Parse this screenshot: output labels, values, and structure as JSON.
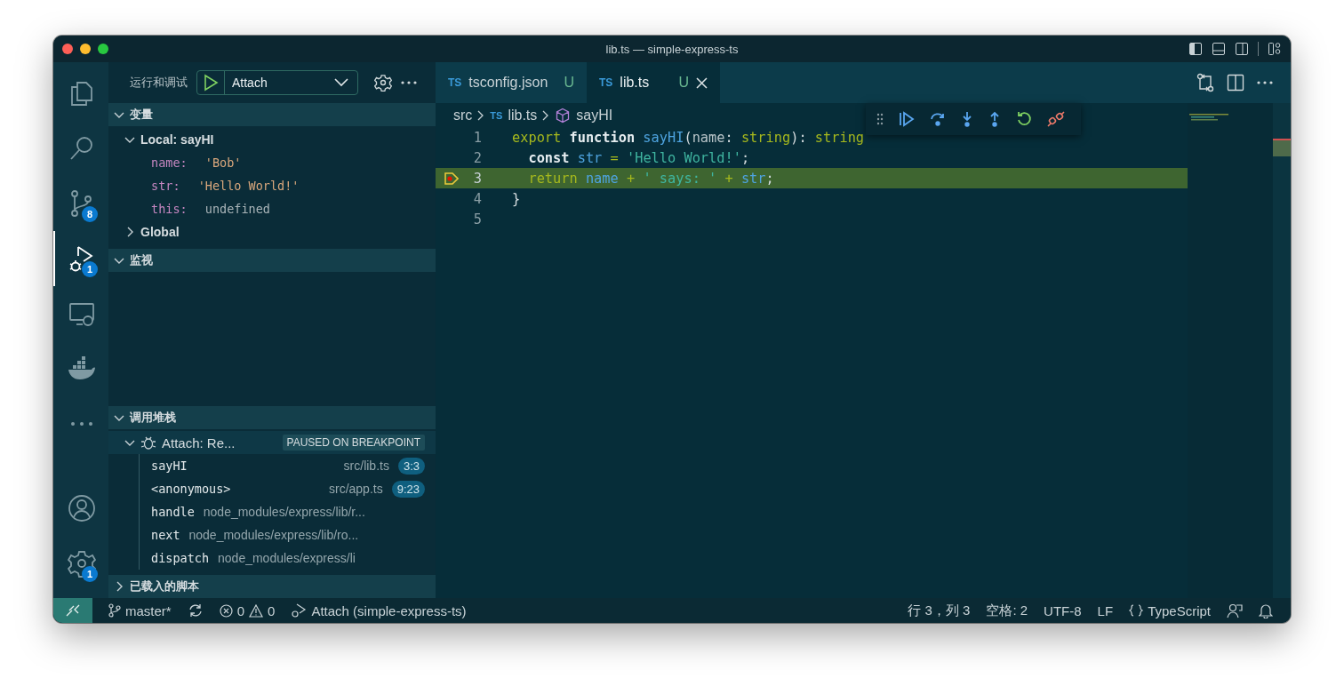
{
  "window": {
    "title": "lib.ts — simple-express-ts"
  },
  "activity_bar": {
    "top": [
      {
        "kind": "explorer",
        "selected": false
      },
      {
        "kind": "search",
        "selected": false
      },
      {
        "kind": "scm",
        "selected": false,
        "badge": "8"
      },
      {
        "kind": "debug",
        "selected": true,
        "badge": "1"
      },
      {
        "kind": "remote",
        "selected": false
      },
      {
        "kind": "docker",
        "selected": false
      },
      {
        "kind": "more",
        "selected": false
      }
    ],
    "bottom": [
      {
        "kind": "account",
        "selected": false
      },
      {
        "kind": "settings",
        "selected": false,
        "badge": "1"
      }
    ]
  },
  "sidebar": {
    "title": "运行和调试",
    "config": "Attach",
    "sections": [
      {
        "kind": "variables",
        "title": "变量",
        "expanded": true
      },
      {
        "kind": "watch",
        "title": "监视",
        "expanded": true
      },
      {
        "kind": "callstack",
        "title": "调用堆栈",
        "expanded": true
      },
      {
        "kind": "scripts",
        "title": "已载入的脚本",
        "expanded": false
      }
    ],
    "scopes": [
      {
        "label": "Local: sayHI",
        "expanded": true,
        "children": [
          {
            "name": "name:",
            "value": "'Bob'",
            "kind": "string"
          },
          {
            "name": "str:",
            "value": "'Hello World!'",
            "kind": "string"
          },
          {
            "name": "this:",
            "value": "undefined",
            "kind": "undefined"
          }
        ]
      },
      {
        "label": "Global",
        "expanded": false
      }
    ],
    "session": {
      "label": "Attach: Re...",
      "status": "PAUSED ON BREAKPOINT",
      "expanded": true
    },
    "frames": [
      {
        "name": "sayHI",
        "source": "src/lib.ts",
        "position": "3:3"
      },
      {
        "name": "<anonymous>",
        "source": "src/app.ts",
        "position": "9:23"
      },
      {
        "name": "handle",
        "source": "node_modules/express/lib/r..."
      },
      {
        "name": "next",
        "source": "node_modules/express/lib/ro..."
      },
      {
        "name": "dispatch",
        "source": "node_modules/express/li"
      }
    ]
  },
  "tabs": [
    {
      "icon_label": "TS",
      "label": "tsconfig.json",
      "decoration": "U",
      "selected": false
    },
    {
      "icon_label": "TS",
      "label": "lib.ts",
      "decoration": "U",
      "selected": true
    }
  ],
  "breadcrumbs": [
    {
      "kind": "folder",
      "label": "src"
    },
    {
      "kind": "file",
      "icon_label": "TS",
      "label": "lib.ts"
    },
    {
      "kind": "symbol",
      "label": "sayHI"
    }
  ],
  "code": [
    {
      "number": "1",
      "current": false,
      "breakpoint": false,
      "tokens": [
        {
          "kind": "keyword",
          "text": "export "
        },
        {
          "kind": "storage",
          "text": "function "
        },
        {
          "kind": "func",
          "text": "sayHI"
        },
        {
          "kind": "plain",
          "text": "("
        },
        {
          "kind": "param",
          "text": "name"
        },
        {
          "kind": "plain",
          "text": ": "
        },
        {
          "kind": "keyword",
          "text": "string"
        },
        {
          "kind": "plain",
          "text": "): "
        },
        {
          "kind": "keyword",
          "text": "string"
        }
      ]
    },
    {
      "number": "2",
      "current": false,
      "breakpoint": false,
      "tokens": [
        {
          "kind": "storage",
          "text": "  const "
        },
        {
          "kind": "ident",
          "text": "str"
        },
        {
          "kind": "keyword",
          "text": " = "
        },
        {
          "kind": "string",
          "text": "'Hello World!'"
        },
        {
          "kind": "plain",
          "text": ";"
        }
      ]
    },
    {
      "number": "3",
      "current": true,
      "breakpoint": true,
      "tokens": [
        {
          "kind": "keyword",
          "text": "  return "
        },
        {
          "kind": "ident",
          "text": "name"
        },
        {
          "kind": "keyword",
          "text": " + "
        },
        {
          "kind": "string",
          "text": "' says: '"
        },
        {
          "kind": "keyword",
          "text": " + "
        },
        {
          "kind": "ident",
          "text": "str"
        },
        {
          "kind": "plain",
          "text": ";"
        }
      ]
    },
    {
      "number": "4",
      "current": false,
      "breakpoint": false,
      "tokens": [
        {
          "kind": "plain",
          "text": "}"
        }
      ]
    },
    {
      "number": "5",
      "current": false,
      "breakpoint": false
    }
  ],
  "status_bar": {
    "branch": "master*",
    "errors": "0",
    "warnings": "0",
    "debug_target": "Attach (simple-express-ts)",
    "cursor": "行 3，列 3",
    "indent": "空格: 2",
    "encoding": "UTF-8",
    "eol": "LF",
    "language": "TypeScript"
  }
}
